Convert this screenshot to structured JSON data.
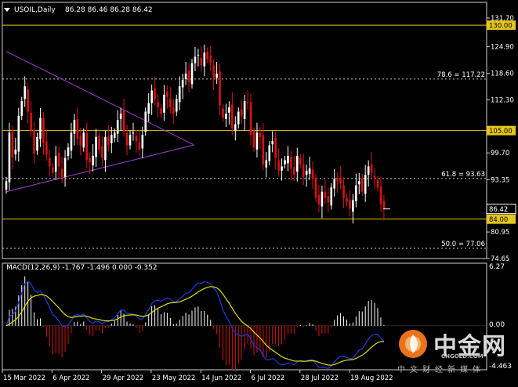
{
  "header": {
    "symbol_label": "USOIL,Daily",
    "ohlc_label": "86.28 86.46 86.28 86.42"
  },
  "macd": {
    "label": "MACD(12,26,9) -1.767 -1.496 0.000 -0.352",
    "axis_top": "6.27",
    "axis_zero": "0.00",
    "axis_bottom": "-4.463",
    "ylim": [
      -4.463,
      6.27
    ]
  },
  "colors": {
    "background": "#000000",
    "bull_candle": "#ffffff",
    "bear_candle": "#dd1111",
    "horizontal_line": "#e6c619",
    "triangle_line": "#a040d0",
    "macd_line": "#1a3fd8",
    "signal_line": "#e0e000",
    "hist_positive": "#ffffff",
    "hist_negative": "#dd1111"
  },
  "chart_data": {
    "type": "candlestick",
    "title": "USOIL,Daily",
    "ylim": [
      74.65,
      131.7
    ],
    "y_ticks": [
      "131.70",
      "124.90",
      "118.60",
      "112.30",
      "105.15",
      "99.70",
      "93.35",
      "86.95",
      "80.95",
      "74.65"
    ],
    "x_tick_labels": [
      "15 Mar 2022",
      "6 Apr 2022",
      "29 Apr 2022",
      "23 May 2022",
      "14 Jun 2022",
      "6 Jul 2022",
      "28 Jul 2022",
      "19 Aug 2022"
    ],
    "current_price_label": "86.42",
    "horizontal_lines": [
      {
        "value": 130.0,
        "tag": "130.00",
        "style": "solid"
      },
      {
        "value": 105.0,
        "tag": "105.00",
        "style": "solid"
      },
      {
        "value": 84.0,
        "tag": "84.00",
        "style": "solid"
      }
    ],
    "fib_levels": [
      {
        "value": 117.22,
        "label": "78.6 = 117.22"
      },
      {
        "value": 93.63,
        "label": "61.8 = 93.63"
      },
      {
        "value": 77.06,
        "label": "50.0 = 77.06"
      }
    ],
    "triangle": {
      "upper": {
        "from": [
          "2022-03-10",
          123.8
        ],
        "to": [
          "2022-06-01",
          101.6
        ]
      },
      "lower": {
        "from": [
          "2022-03-10",
          90.5
        ],
        "to": [
          "2022-06-01",
          101.6
        ]
      }
    },
    "closes": [
      93.0,
      104.5,
      98.6,
      100.5,
      108.5,
      112.0,
      115.5,
      109.5,
      105.0,
      99.5,
      103.5,
      108.0,
      102.0,
      99.3,
      96.5,
      95.0,
      99.0,
      96.5,
      94.0,
      98.5,
      101.0,
      104.5,
      107.5,
      103.0,
      101.5,
      104.5,
      98.0,
      97.5,
      99.0,
      103.5,
      100.5,
      98.5,
      103.5,
      101.5,
      104.0,
      104.5,
      107.5,
      109.0,
      105.0,
      101.5,
      104.0,
      104.5,
      102.5,
      100.5,
      104.0,
      109.5,
      111.5,
      114.5,
      112.5,
      110.5,
      109.0,
      113.5,
      113.0,
      110.5,
      109.0,
      112.5,
      115.5,
      117.0,
      118.5,
      116.5,
      121.0,
      122.5,
      123.0,
      120.5,
      123.5,
      122.0,
      121.0,
      117.5,
      118.5,
      111.0,
      108.0,
      109.0,
      110.5,
      105.5,
      106.5,
      109.5,
      108.5,
      112.0,
      111.5,
      104.0,
      101.0,
      104.5,
      103.5,
      97.0,
      98.0,
      101.5,
      102.5,
      98.5,
      95.5,
      96.5,
      98.0,
      99.0,
      96.0,
      94.5,
      99.0,
      97.0,
      94.0,
      95.5,
      96.0,
      93.5,
      89.0,
      87.5,
      90.5,
      89.0,
      88.0,
      91.5,
      93.5,
      93.0,
      92.5,
      89.0,
      88.0,
      86.5,
      88.5,
      92.0,
      93.0,
      90.5,
      94.5,
      96.5,
      95.0,
      93.5,
      91.5,
      87.5,
      86.42
    ]
  }
}
